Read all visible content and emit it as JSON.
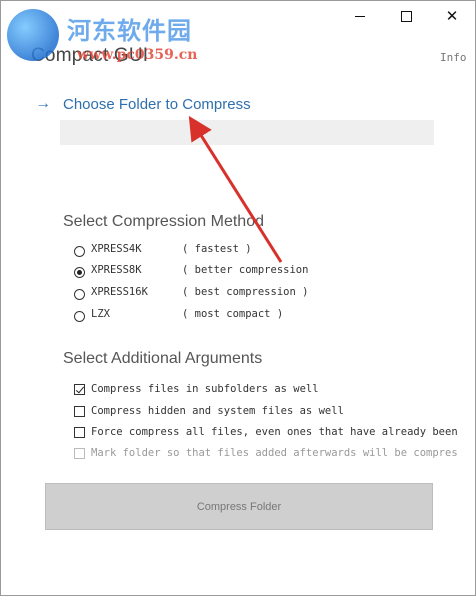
{
  "window": {
    "title": "Compact GUI",
    "info_link": "Info",
    "controls": {
      "minimize": "minimize",
      "maximize": "maximize",
      "close": "✕"
    }
  },
  "watermark": {
    "text": "河东软件园",
    "url": "www.pc0359.cn"
  },
  "folder": {
    "choose_label": "Choose Folder to Compress",
    "path_value": ""
  },
  "compression": {
    "title": "Select Compression Method",
    "options": [
      {
        "name": "XPRESS4K",
        "desc": "( fastest )",
        "selected": false
      },
      {
        "name": "XPRESS8K",
        "desc": "( better compression",
        "selected": true
      },
      {
        "name": "XPRESS16K",
        "desc": "( best compression )",
        "selected": false
      },
      {
        "name": "LZX",
        "desc": "( most compact )",
        "selected": false
      }
    ]
  },
  "arguments": {
    "title": "Select Additional Arguments",
    "options": [
      {
        "label": "Compress files in subfolders as well",
        "checked": true,
        "disabled": false
      },
      {
        "label": "Compress hidden and system files as well",
        "checked": false,
        "disabled": false
      },
      {
        "label": "Force compress all files, even ones that have already been compressed",
        "checked": false,
        "disabled": false
      },
      {
        "label": "Mark folder so that files added afterwards will be compressed",
        "checked": false,
        "disabled": true
      }
    ]
  },
  "actions": {
    "compress_label": "Compress Folder"
  },
  "colors": {
    "accent": "#2f6fad",
    "annotation_arrow": "#d8302a",
    "button_bg": "#cfcfcf"
  }
}
